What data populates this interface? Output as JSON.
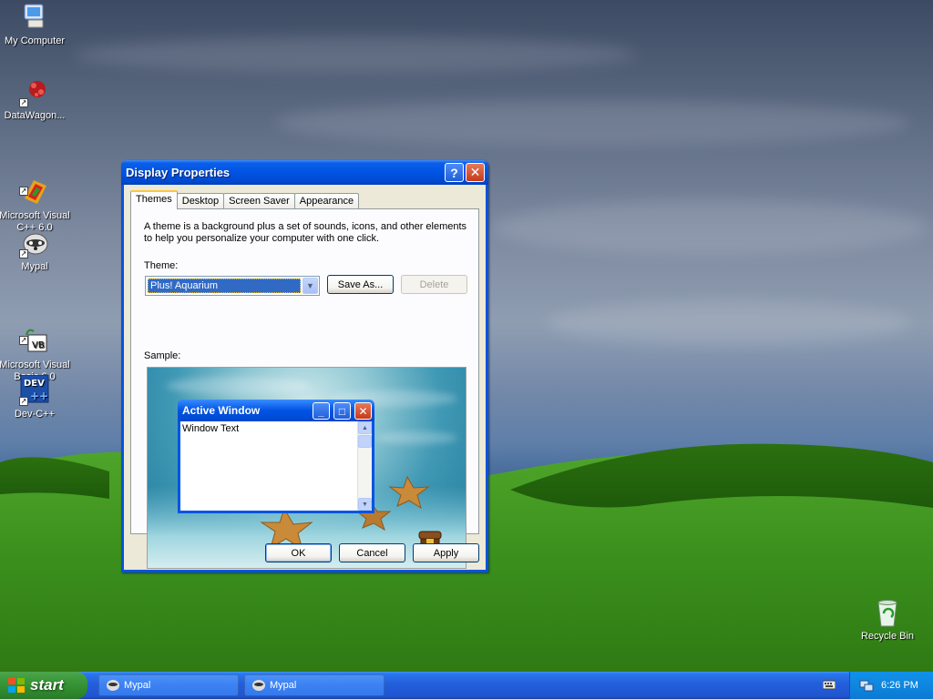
{
  "desktop": {
    "icons": [
      {
        "label": "My Computer",
        "icon": "computer-icon"
      },
      {
        "label": "DataWagon...",
        "icon": "datawagon-icon"
      },
      {
        "label": "Microsoft Visual\nC++ 6.0",
        "icon": "visual-cpp-icon"
      },
      {
        "label": "Mypal",
        "icon": "mypal-icon"
      },
      {
        "label": "Microsoft Visual\nBasic 6.0",
        "icon": "visual-basic-icon"
      },
      {
        "label": "Dev-C++",
        "icon": "devcpp-icon"
      },
      {
        "label": "Recycle Bin",
        "icon": "recycle-bin-icon"
      }
    ]
  },
  "dialog": {
    "title": "Display Properties",
    "help_glyph": "?",
    "close_glyph": "✕",
    "tabs": [
      {
        "label": "Themes",
        "active": true
      },
      {
        "label": "Desktop",
        "active": false
      },
      {
        "label": "Screen Saver",
        "active": false
      },
      {
        "label": "Appearance",
        "active": false
      }
    ],
    "description": "A theme is a background plus a set of sounds, icons, and other elements to help you personalize your computer with one click.",
    "theme_label": "Theme:",
    "theme_value": "Plus! Aquarium",
    "save_as_label": "Save As...",
    "delete_label": "Delete",
    "sample_label": "Sample:",
    "sample": {
      "window_title": "Active Window",
      "window_text": "Window Text"
    },
    "ok_label": "OK",
    "cancel_label": "Cancel",
    "apply_label": "Apply"
  },
  "taskbar": {
    "start_label": "start",
    "tasks": [
      {
        "label": "Mypal"
      },
      {
        "label": "Mypal"
      }
    ],
    "clock": "6:26 PM"
  },
  "colors": {
    "title_blue": "#0054e3",
    "start_green": "#3c9a3b",
    "taskbar_blue": "#245edb",
    "tray_blue": "#0e87e0",
    "dialog_face": "#ece9d8"
  }
}
